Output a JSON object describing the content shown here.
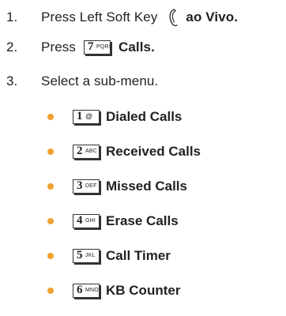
{
  "steps": [
    {
      "number": "1.",
      "text": "Press Left Soft Key",
      "bold": "ao Vivo",
      "trailing": "."
    },
    {
      "number": "2.",
      "text": "Press",
      "key": {
        "num": "7",
        "sub": "PQRS"
      },
      "bold": "Calls",
      "trailing": "."
    },
    {
      "number": "3.",
      "text": "Select a sub-menu."
    }
  ],
  "submenu": [
    {
      "key_num": "1",
      "key_sub": "@",
      "label": "Dialed Calls"
    },
    {
      "key_num": "2",
      "key_sub": "ABC",
      "label": "Received Calls"
    },
    {
      "key_num": "3",
      "key_sub": "DEF",
      "label": "Missed Calls"
    },
    {
      "key_num": "4",
      "key_sub": "GHI",
      "label": "Erase Calls"
    },
    {
      "key_num": "5",
      "key_sub": "JKL",
      "label": "Call Timer"
    },
    {
      "key_num": "6",
      "key_sub": "MNO",
      "label": "KB Counter"
    }
  ],
  "colors": {
    "bullet": "#f0a030",
    "text": "#222222"
  },
  "icons": {
    "soft_key": "left-soft-key-icon"
  }
}
